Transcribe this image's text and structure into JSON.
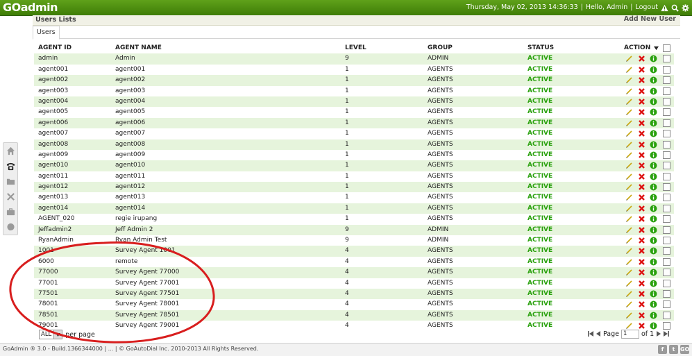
{
  "header": {
    "logo": "GOadmin",
    "datetime": "Thursday, May 02, 2013 14:36:33",
    "greeting": "Hello, Admin",
    "logout": "Logout"
  },
  "sidebar": [
    "home-icon",
    "phone-icon",
    "folder-icon",
    "tools-icon",
    "briefcase-icon",
    "help-icon"
  ],
  "panel": {
    "title": "Users Lists",
    "add_user": "Add New User",
    "tab": "Users"
  },
  "table": {
    "columns": [
      "AGENT ID",
      "AGENT NAME",
      "LEVEL",
      "GROUP",
      "STATUS",
      "ACTION"
    ],
    "rows": [
      {
        "id": "admin",
        "name": "Admin",
        "level": "9",
        "group": "ADMIN",
        "status": "ACTIVE"
      },
      {
        "id": "agent001",
        "name": "agent001",
        "level": "1",
        "group": "AGENTS",
        "status": "ACTIVE"
      },
      {
        "id": "agent002",
        "name": "agent002",
        "level": "1",
        "group": "AGENTS",
        "status": "ACTIVE"
      },
      {
        "id": "agent003",
        "name": "agent003",
        "level": "1",
        "group": "AGENTS",
        "status": "ACTIVE"
      },
      {
        "id": "agent004",
        "name": "agent004",
        "level": "1",
        "group": "AGENTS",
        "status": "ACTIVE"
      },
      {
        "id": "agent005",
        "name": "agent005",
        "level": "1",
        "group": "AGENTS",
        "status": "ACTIVE"
      },
      {
        "id": "agent006",
        "name": "agent006",
        "level": "1",
        "group": "AGENTS",
        "status": "ACTIVE"
      },
      {
        "id": "agent007",
        "name": "agent007",
        "level": "1",
        "group": "AGENTS",
        "status": "ACTIVE"
      },
      {
        "id": "agent008",
        "name": "agent008",
        "level": "1",
        "group": "AGENTS",
        "status": "ACTIVE"
      },
      {
        "id": "agent009",
        "name": "agent009",
        "level": "1",
        "group": "AGENTS",
        "status": "ACTIVE"
      },
      {
        "id": "agent010",
        "name": "agent010",
        "level": "1",
        "group": "AGENTS",
        "status": "ACTIVE"
      },
      {
        "id": "agent011",
        "name": "agent011",
        "level": "1",
        "group": "AGENTS",
        "status": "ACTIVE"
      },
      {
        "id": "agent012",
        "name": "agent012",
        "level": "1",
        "group": "AGENTS",
        "status": "ACTIVE"
      },
      {
        "id": "agent013",
        "name": "agent013",
        "level": "1",
        "group": "AGENTS",
        "status": "ACTIVE"
      },
      {
        "id": "agent014",
        "name": "agent014",
        "level": "1",
        "group": "AGENTS",
        "status": "ACTIVE"
      },
      {
        "id": "AGENT_020",
        "name": "regie irupang",
        "level": "1",
        "group": "AGENTS",
        "status": "ACTIVE"
      },
      {
        "id": "Jeffadmin2",
        "name": "Jeff Admin 2",
        "level": "9",
        "group": "ADMIN",
        "status": "ACTIVE"
      },
      {
        "id": "RyanAdmin",
        "name": "Ryan Admin Test",
        "level": "9",
        "group": "ADMIN",
        "status": "ACTIVE"
      },
      {
        "id": "1001",
        "name": "Survey Agent 1001",
        "level": "4",
        "group": "AGENTS",
        "status": "ACTIVE"
      },
      {
        "id": "6000",
        "name": "remote",
        "level": "4",
        "group": "AGENTS",
        "status": "ACTIVE"
      },
      {
        "id": "77000",
        "name": "Survey Agent 77000",
        "level": "4",
        "group": "AGENTS",
        "status": "ACTIVE"
      },
      {
        "id": "77001",
        "name": "Survey Agent 77001",
        "level": "4",
        "group": "AGENTS",
        "status": "ACTIVE"
      },
      {
        "id": "77501",
        "name": "Survey Agent 77501",
        "level": "4",
        "group": "AGENTS",
        "status": "ACTIVE"
      },
      {
        "id": "78001",
        "name": "Survey Agent 78001",
        "level": "4",
        "group": "AGENTS",
        "status": "ACTIVE"
      },
      {
        "id": "78501",
        "name": "Survey Agent 78501",
        "level": "4",
        "group": "AGENTS",
        "status": "ACTIVE"
      },
      {
        "id": "79001",
        "name": "Survey Agent 79001",
        "level": "4",
        "group": "AGENTS",
        "status": "ACTIVE"
      }
    ]
  },
  "pager": {
    "per_page_value": "ALL",
    "per_page_label": "per page",
    "page_label": "Page",
    "page_value": "1",
    "of_label": "of 1"
  },
  "footer": {
    "text": "GoAdmin ® 3.0 - Build.1366344000 | ... | © GoAutoDial Inc. 2010-2013 All Rights Reserved.",
    "social": [
      "f",
      "t",
      "GO"
    ]
  },
  "colors": {
    "topbar": "#4e8f10",
    "row_alt": "#e6f4dc",
    "status_active": "#2aa10e",
    "annotation": "#d81e1e"
  }
}
